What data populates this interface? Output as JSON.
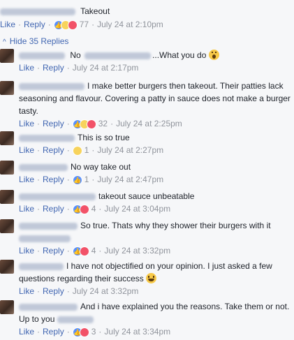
{
  "colors": {
    "link": "#4267b2",
    "meta": "#90949c",
    "text": "#1d2129",
    "background": "#f6f7f9"
  },
  "top_comment": {
    "text": "Takeout",
    "like": "Like",
    "reply": "Reply",
    "reactions": [
      "like-icon",
      "haha-icon",
      "love-icon"
    ],
    "count": "77",
    "time": "July 24 at 2:10pm"
  },
  "hide_replies": {
    "chevron": "^",
    "label": "Hide 35 Replies"
  },
  "replies": [
    {
      "pre": "No",
      "post": "...What you do",
      "emoji": "wow-emoji",
      "like": "Like",
      "reply": "Reply",
      "count": "",
      "time": "July 24 at 2:17pm"
    },
    {
      "text": "I make better burgers then takeout. Their patties lack seasoning and flavour. Covering a patty in sauce does not make a burger tasty.",
      "like": "Like",
      "reply": "Reply",
      "count": "32",
      "time": "July 24 at 2:25pm"
    },
    {
      "text": "This is so true",
      "like": "Like",
      "reply": "Reply",
      "count": "1",
      "time": "July 24 at 2:27pm"
    },
    {
      "text": "No way take out",
      "like": "Like",
      "reply": "Reply",
      "count": "1",
      "time": "July 24 at 2:47pm"
    },
    {
      "text": "takeout sauce unbeatable",
      "like": "Like",
      "reply": "Reply",
      "count": "4",
      "time": "July 24 at 3:04pm"
    },
    {
      "text": "So true. Thats why they shower their burgers with it",
      "like": "Like",
      "reply": "Reply",
      "count": "4",
      "time": "July 24 at 3:32pm"
    },
    {
      "text": "I have not objectified on your opinion. I just asked a few questions regarding their success",
      "emoji": "laugh-emoji",
      "like": "Like",
      "reply": "Reply",
      "count": "",
      "time": "July 24 at 3:32pm"
    },
    {
      "text": "And i have explained you the reasons. Take them or not. Up to you",
      "like": "Like",
      "reply": "Reply",
      "count": "3",
      "time": "July 24 at 3:34pm"
    }
  ]
}
